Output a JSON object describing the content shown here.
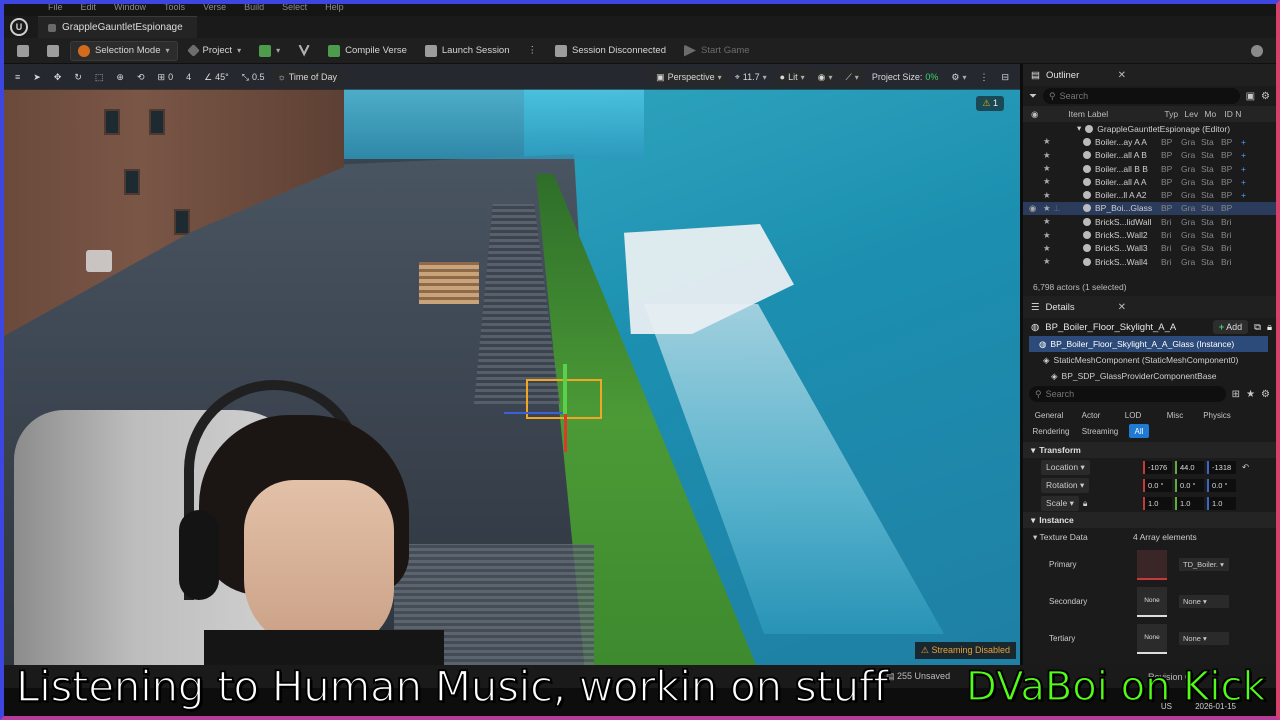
{
  "menu": [
    "File",
    "Edit",
    "Window",
    "Tools",
    "Verse",
    "Build",
    "Select",
    "Help"
  ],
  "tab": {
    "level_name": "GrappleGauntletEspionage"
  },
  "toolbar": {
    "selection_mode": "Selection Mode",
    "project": "Project",
    "compile_verse": "Compile Verse",
    "launch_session": "Launch Session",
    "session_status": "Session Disconnected",
    "start_game": "Start Game"
  },
  "viewport": {
    "rotate_snap": "0",
    "scale_count": "4",
    "angle": "45°",
    "scale_snap": "0.5",
    "time_of_day": "Time of Day",
    "perspective": "Perspective",
    "fov": "11.7",
    "lit": "Lit",
    "project_size_label": "Project Size:",
    "project_size_value": "0%",
    "warning_count": "1",
    "streaming": "Streaming Disabled"
  },
  "outliner": {
    "title": "Outliner",
    "search_placeholder": "Search",
    "columns": {
      "label": "Item Label",
      "type": "Typ",
      "level": "Lev",
      "mod": "Mo",
      "id": "ID N"
    },
    "root": "GrappleGauntletEspionage (Editor)",
    "rows": [
      {
        "name": "Boiler...ay A A",
        "c1": "BP",
        "c2": "Gra",
        "c3": "Sta",
        "c4": "BP",
        "plus": "+",
        "selected": false
      },
      {
        "name": "Boiler...all A B",
        "c1": "BP",
        "c2": "Gra",
        "c3": "Sta",
        "c4": "BP",
        "plus": "+",
        "selected": false
      },
      {
        "name": "Boiler...all B B",
        "c1": "BP",
        "c2": "Gra",
        "c3": "Sta",
        "c4": "BP",
        "plus": "+",
        "selected": false
      },
      {
        "name": "Boiler...all A A",
        "c1": "BP",
        "c2": "Gra",
        "c3": "Sta",
        "c4": "BP",
        "plus": "+",
        "selected": false
      },
      {
        "name": "Boiler...ll A A2",
        "c1": "BP",
        "c2": "Gra",
        "c3": "Sta",
        "c4": "BP",
        "plus": "+",
        "selected": false
      },
      {
        "name": "BP_Boi...Glass",
        "c1": "BP",
        "c2": "Gra",
        "c3": "Sta",
        "c4": "BP",
        "plus": "",
        "selected": true
      },
      {
        "name": "BrickS...lidWall",
        "c1": "Bri",
        "c2": "Gra",
        "c3": "Sta",
        "c4": "Bri",
        "plus": "",
        "selected": false
      },
      {
        "name": "BrickS...Wall2",
        "c1": "Bri",
        "c2": "Gra",
        "c3": "Sta",
        "c4": "Bri",
        "plus": "",
        "selected": false
      },
      {
        "name": "BrickS...Wall3",
        "c1": "Bri",
        "c2": "Gra",
        "c3": "Sta",
        "c4": "Bri",
        "plus": "",
        "selected": false
      },
      {
        "name": "BrickS...Wall4",
        "c1": "Bri",
        "c2": "Gra",
        "c3": "Sta",
        "c4": "Bri",
        "plus": "",
        "selected": false
      }
    ],
    "actors_count": "6,798 actors (1 selected)"
  },
  "details": {
    "title": "Details",
    "actor_name": "BP_Boiler_Floor_Skylight_A_A",
    "add_label": "Add",
    "instance_row": "BP_Boiler_Floor_Skylight_A_A_Glass (Instance)",
    "component_1": "StaticMeshComponent (StaticMeshComponent0)",
    "component_2": "BP_SDP_GlassProviderComponentBase",
    "search_placeholder": "Search",
    "tabs": [
      "General",
      "Actor",
      "LOD",
      "Misc",
      "Physics",
      "Rendering",
      "Streaming",
      "All"
    ],
    "transform_header": "Transform",
    "location_label": "Location",
    "location": [
      "-1076",
      "44.0",
      "-1318"
    ],
    "rotation_label": "Rotation",
    "rotation": [
      "0.0 °",
      "0.0 °",
      "0.0 °"
    ],
    "scale_label": "Scale",
    "scale": [
      "1.0",
      "1.0",
      "1.0"
    ],
    "instance_header": "Instance",
    "texture_data_label": "Texture Data",
    "texture_data_value": "4 Array elements",
    "primary_label": "Primary",
    "primary_value": "TD_Boiler.",
    "secondary_label": "Secondary",
    "secondary_value": "None",
    "tertiary_label": "Tertiary",
    "tertiary_value": "None",
    "none_thumb": "None"
  },
  "status": {
    "unsaved": "255 Unsaved",
    "revision": "Revision C",
    "date": "2026-01-15",
    "lang": "US"
  },
  "overlay": {
    "caption": "Listening to Human Music, workin on stuff",
    "channel": "DVaBoi on Kick"
  },
  "colors": {
    "accent_green": "#53fc18",
    "selection_blue": "#1e7ad2",
    "gizmo_yellow": "#f2a623",
    "frame_blue": "#3d46e0",
    "frame_pink": "#d8406a"
  }
}
